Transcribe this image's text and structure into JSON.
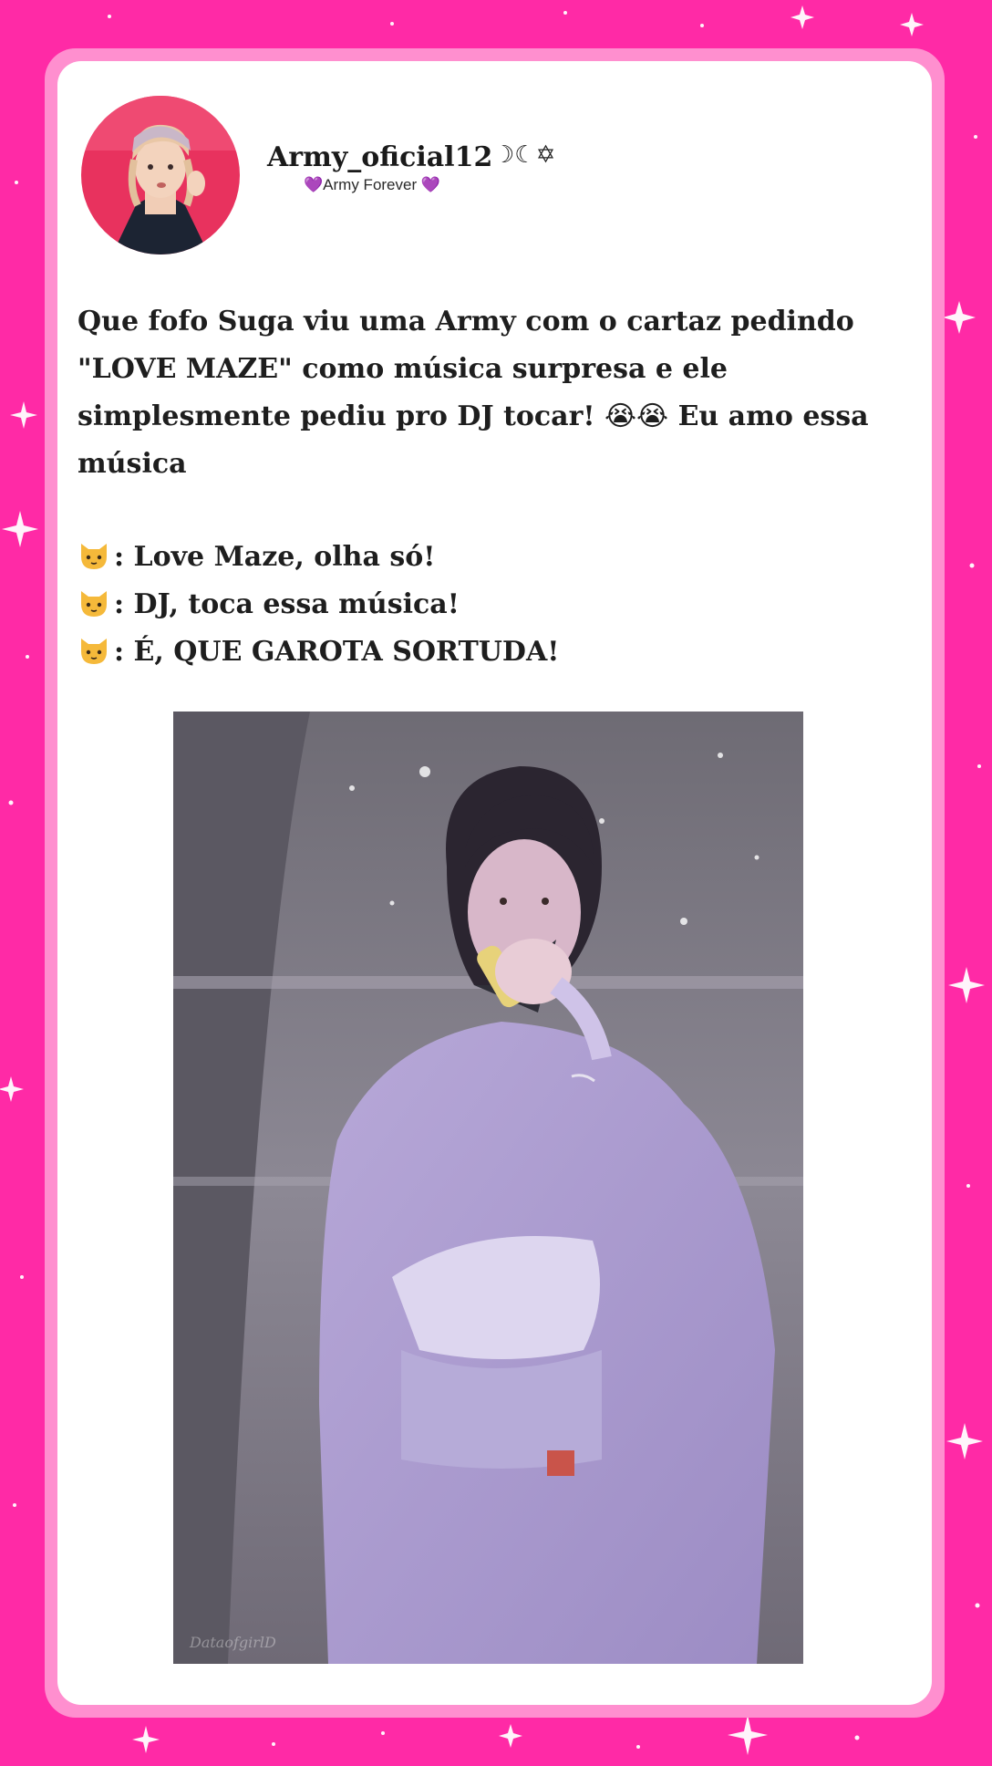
{
  "post": {
    "username": "Army_oficial12",
    "username_decoration": "☽☾✡",
    "tagline_heart_left": "💜",
    "tagline": "Army Forever",
    "tagline_heart_right": "💜",
    "text_lines": [
      "Que fofo Suga viu uma Army com o cartaz pedindo",
      "\"LOVE MAZE\" como música surpresa e ele",
      "simplesmente pediu pro DJ tocar!",
      "música"
    ],
    "line3_emoji": "😭😭",
    "line3_suffix": "Eu amo essa",
    "quotes": [
      {
        "icon": "cat-face-icon",
        "text": ": Love Maze, olha só!"
      },
      {
        "icon": "cat-face-icon",
        "text": ": DJ, toca essa música!"
      },
      {
        "icon": "cat-face-icon",
        "text": ": É, QUE GAROTA SORTUDA!"
      }
    ],
    "media_watermark": "DataofgirlD"
  },
  "colors": {
    "background": "#ff2aa6",
    "card_border": "#ff8fcf",
    "card": "#ffffff",
    "avatar_bg": "#e8325e",
    "text": "#1e1e1e",
    "heart": "#a24ad6"
  }
}
